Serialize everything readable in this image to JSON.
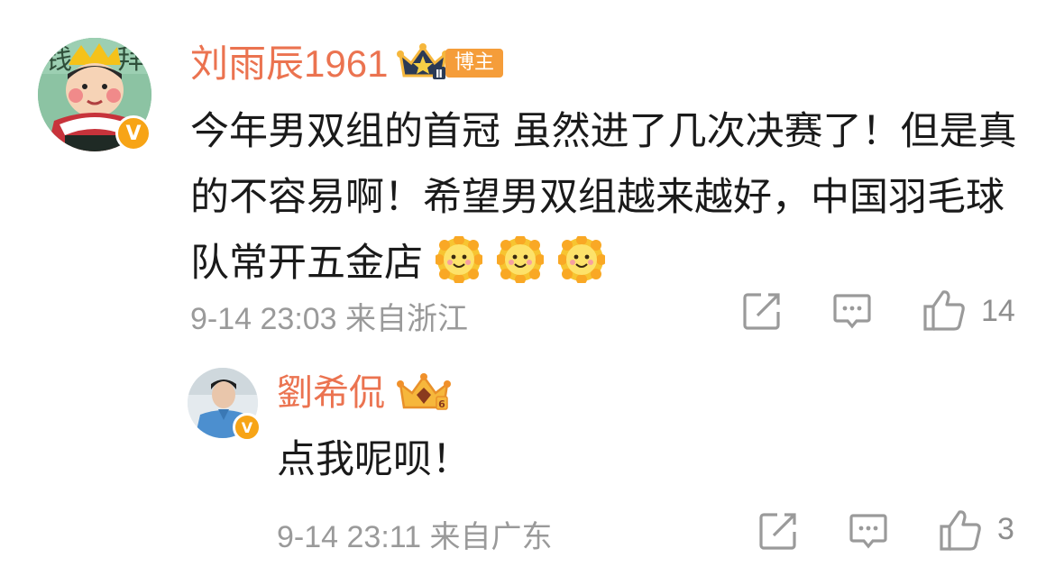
{
  "main_comment": {
    "username": "刘雨辰1961",
    "badge_label": "博主",
    "text": "今年男双组的首冠 虽然进了几次决赛了！但是真的不容易啊！希望男双组越来越好，中国羽毛球队常开五金店",
    "emojis": [
      "sun-smile-icon",
      "sun-smile-icon",
      "sun-smile-icon"
    ],
    "meta": "9-14 23:03 来自浙江",
    "like_count": "14",
    "verified_icon": "verified-v-icon"
  },
  "reply": {
    "username": "劉希侃",
    "text": "点我呢呗！",
    "meta": "9-14 23:11 来自广东",
    "like_count": "3",
    "verified_icon": "verified-v-icon"
  },
  "colors": {
    "username": "#eb7350",
    "badge_bg": "#f59d3a",
    "verified": "#f7a416",
    "meta": "#9a9a9a",
    "icon": "#9a9a9a"
  }
}
